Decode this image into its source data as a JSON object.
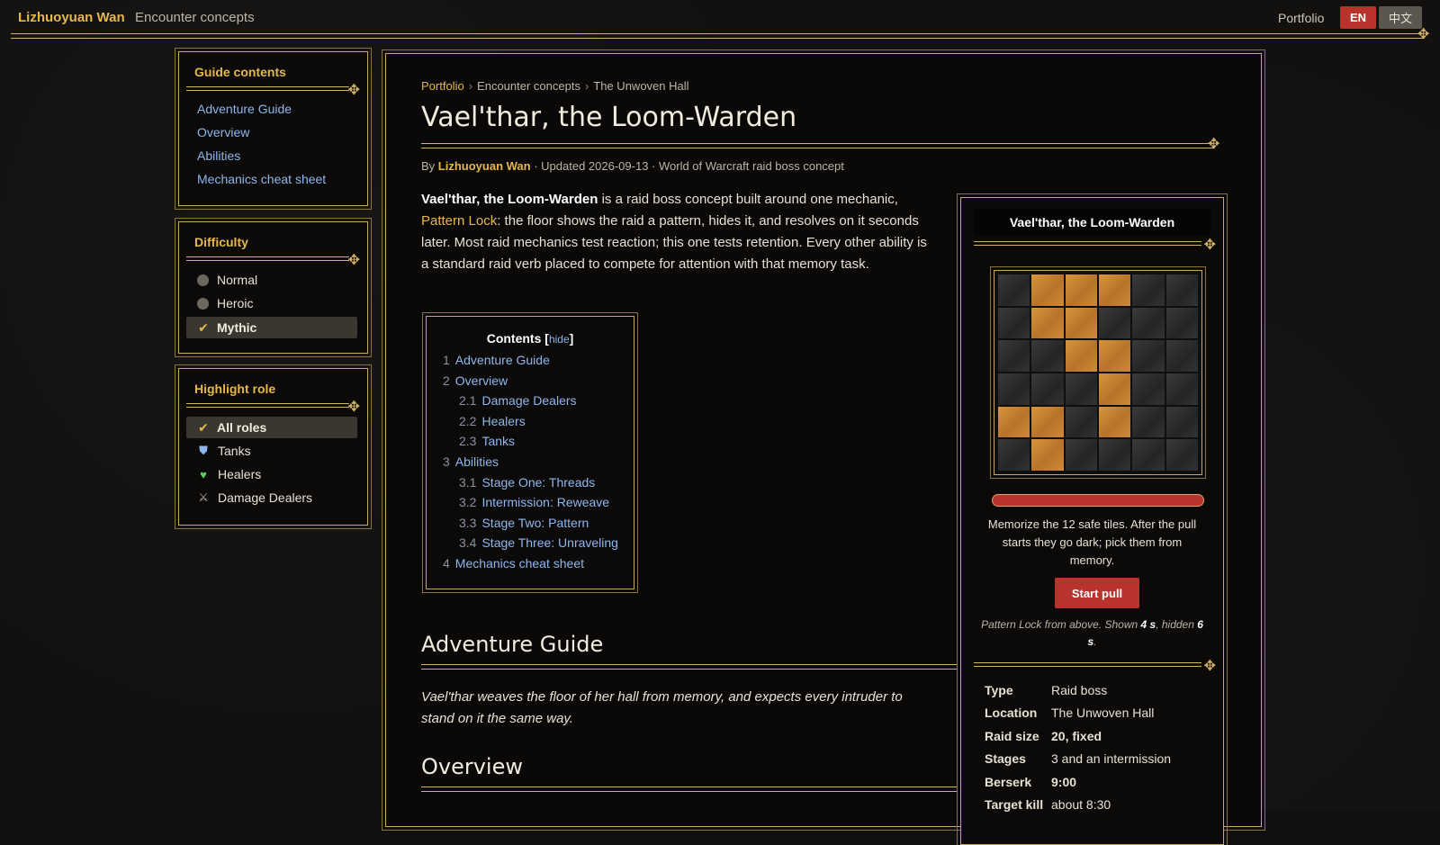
{
  "topbar": {
    "brand": "Lizhuoyuan Wan",
    "section": "Encounter concepts",
    "portfolio_link": "Portfolio",
    "lang_en": "EN",
    "lang_zh": "中文"
  },
  "sidebar": {
    "guide": {
      "title": "Guide contents",
      "links": [
        "Adventure Guide",
        "Overview",
        "Abilities",
        "Mechanics cheat sheet"
      ]
    },
    "difficulty": {
      "title": "Difficulty",
      "options": [
        "Normal",
        "Heroic",
        "Mythic"
      ],
      "selected": "Mythic"
    },
    "roles": {
      "title": "Highlight role",
      "options": [
        "All roles",
        "Tanks",
        "Healers",
        "Damage Dealers"
      ],
      "selected": "All roles"
    }
  },
  "breadcrumb": {
    "items": [
      "Portfolio",
      "Encounter concepts",
      "The Unwoven Hall"
    ],
    "separator": "›"
  },
  "page": {
    "title": "Vael'thar, the Loom-Warden",
    "byline_prefix": "By",
    "byline_author": "Lizhuoyuan Wan",
    "byline_rest": "· Updated 2026-09-13 · World of Warcraft raid boss concept",
    "intro_name": "Vael'thar, the Loom-Warden",
    "intro_1": "is a raid boss concept built around one mechanic,",
    "intro_kw": "Pattern Lock",
    "intro_2": ": the floor shows the raid a pattern, hides it, and resolves on it seconds later. Most raid mechanics test reaction; this one tests retention. Every other ability is a standard raid verb placed to compete for attention with that memory task."
  },
  "toc": {
    "title": "Contents",
    "hide": "hide",
    "items": [
      {
        "num": "1",
        "label": "Adventure Guide"
      },
      {
        "num": "2",
        "label": "Overview"
      },
      {
        "num": "2.1",
        "label": "Damage Dealers"
      },
      {
        "num": "2.2",
        "label": "Healers"
      },
      {
        "num": "2.3",
        "label": "Tanks"
      },
      {
        "num": "3",
        "label": "Abilities"
      },
      {
        "num": "3.1",
        "label": "Stage One: Threads"
      },
      {
        "num": "3.2",
        "label": "Intermission: Reweave"
      },
      {
        "num": "3.3",
        "label": "Stage Two: Pattern"
      },
      {
        "num": "3.4",
        "label": "Stage Three: Unraveling"
      },
      {
        "num": "4",
        "label": "Mechanics cheat sheet"
      }
    ]
  },
  "sections": {
    "adventure_guide": "Adventure Guide",
    "adventure_quote": "Vael'thar weaves the floor of her hall from memory, and expects every intruder to stand on it the same way.",
    "overview": "Overview"
  },
  "infobox": {
    "title": "Vael'thar, the Loom-Warden",
    "safe_tiles": [
      [
        false,
        true,
        true,
        true,
        false,
        false
      ],
      [
        false,
        true,
        true,
        false,
        false,
        false
      ],
      [
        false,
        false,
        true,
        true,
        false,
        false
      ],
      [
        false,
        false,
        false,
        true,
        false,
        false
      ],
      [
        true,
        true,
        false,
        true,
        false,
        false
      ],
      [
        false,
        true,
        false,
        false,
        false,
        false
      ]
    ],
    "instructions": "Memorize the 12 safe tiles. After the pull starts they go dark; pick them from memory.",
    "start_button": "Start pull",
    "note_1": "Pattern Lock from above. Shown",
    "note_shown": "4 s",
    "note_2": ", hidden",
    "note_hidden": "6 s",
    "note_3": ".",
    "stats": [
      {
        "label": "Type",
        "value": "Raid boss",
        "bold": false
      },
      {
        "label": "Location",
        "value": "The Unwoven Hall",
        "bold": false
      },
      {
        "label": "Raid size",
        "value": "20, fixed",
        "bold": true
      },
      {
        "label": "Stages",
        "value": "3 and an intermission",
        "bold": false
      },
      {
        "label": "Berserk",
        "value": "9:00",
        "bold": true
      },
      {
        "label": "Target kill",
        "value": "about 8:30",
        "bold": false
      }
    ]
  },
  "colors": {
    "gold": "#d4b26a",
    "accent_red": "#b8332c",
    "link_blue": "#8fb6ef",
    "highlight_gold": "#e6b84c",
    "safe_tile": "#c6822f"
  },
  "icons": {
    "check": "checkmark-icon",
    "tank": "shield-icon",
    "healer": "heart-icon",
    "dps": "crossed-swords-icon"
  }
}
